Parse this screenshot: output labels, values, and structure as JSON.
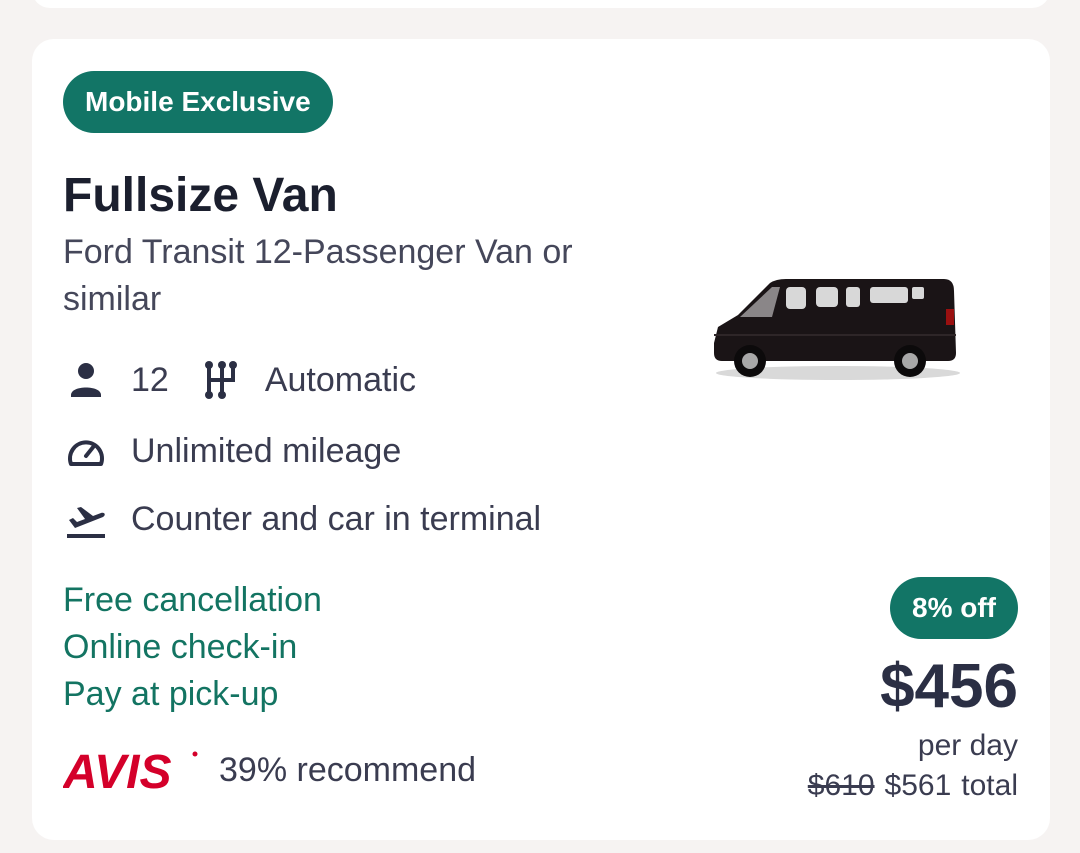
{
  "badge": "Mobile Exclusive",
  "car": {
    "category": "Fullsize Van",
    "model": "Ford Transit 12-Passenger Van or similar",
    "image_alt": "Black Ford Transit passenger van"
  },
  "features": {
    "seats": "12",
    "transmission": "Automatic",
    "mileage": "Unlimited mileage",
    "pickup": "Counter and car in terminal"
  },
  "perks": [
    "Free cancellation",
    "Online check-in",
    "Pay at pick-up"
  ],
  "supplier": {
    "name": "AVIS",
    "recommend": "39% recommend"
  },
  "pricing": {
    "discount": "8% off",
    "price": "$456",
    "per_day": "per day",
    "old_total": "$610",
    "new_total": "$561",
    "total_label": "total"
  },
  "colors": {
    "accent_green": "#127566",
    "perk_text": "#137462",
    "avis_red": "#d4002a"
  },
  "icons": [
    "person-icon",
    "gearshift-icon",
    "speedometer-icon",
    "airplane-departure-icon"
  ]
}
